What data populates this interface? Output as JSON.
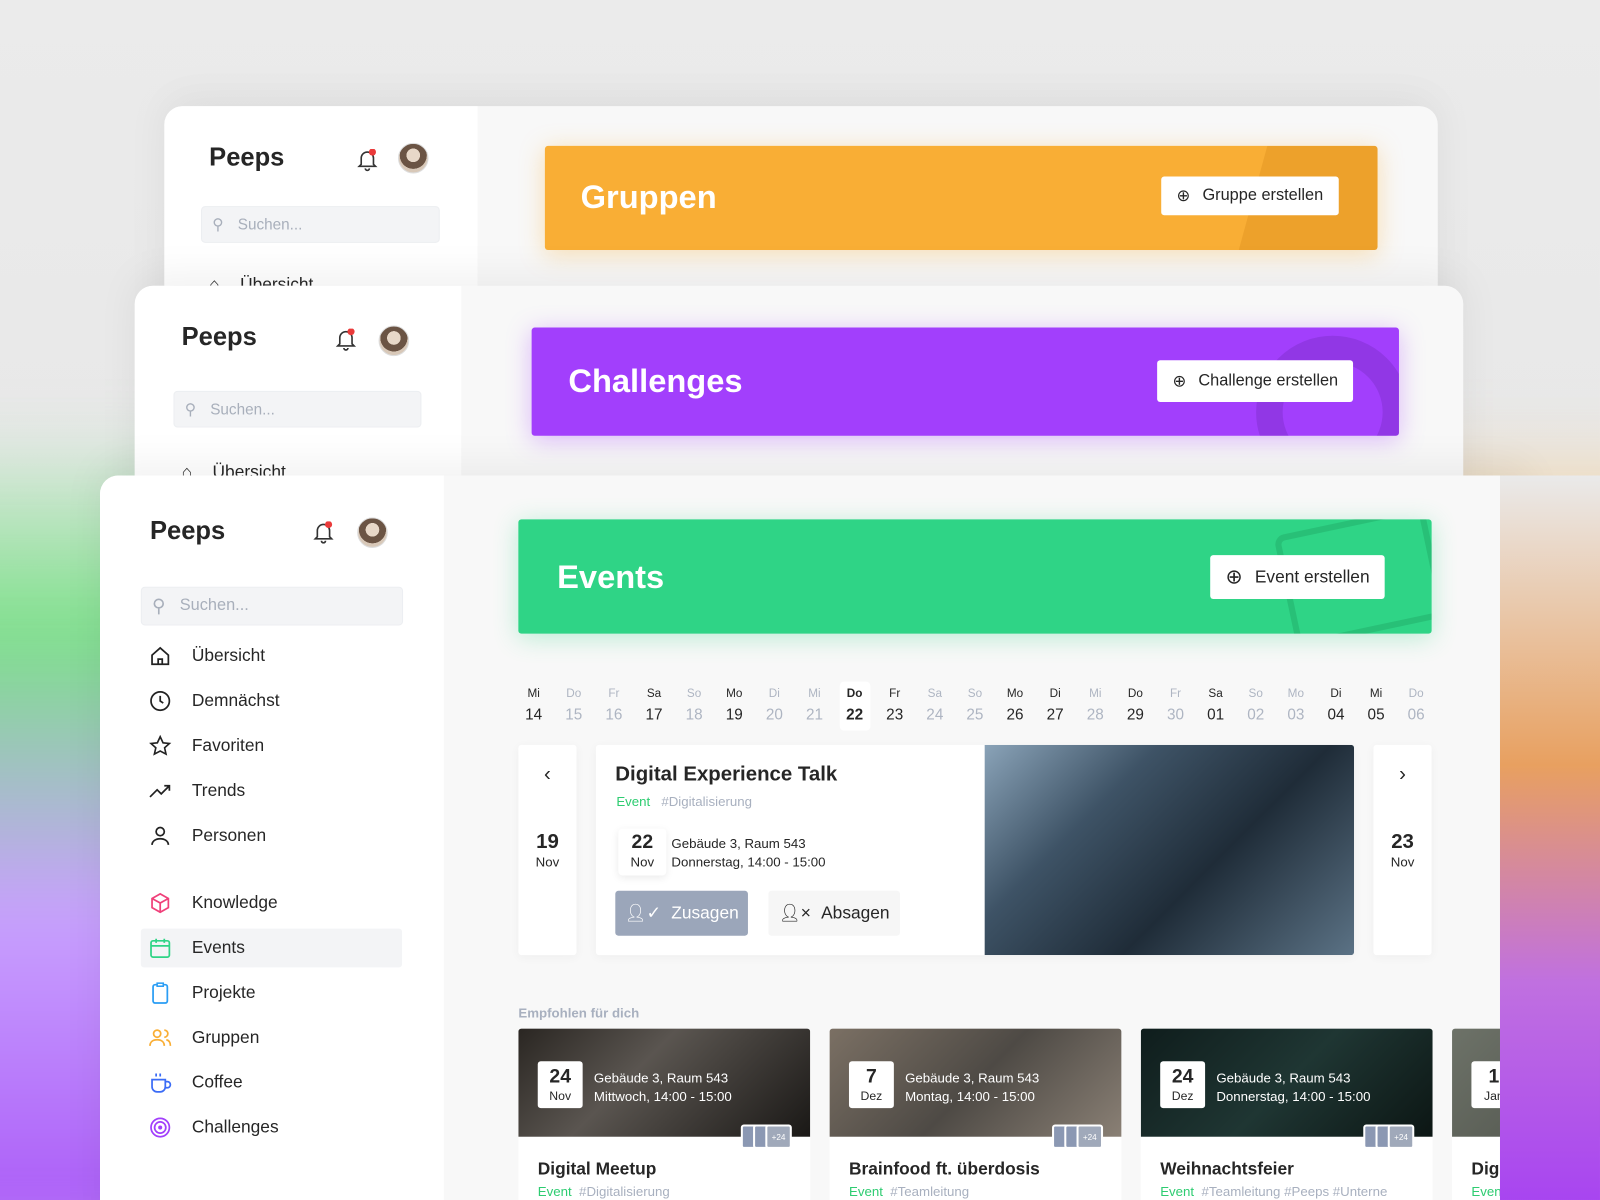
{
  "app_name": "Peeps",
  "search_placeholder": "Suchen...",
  "windows": {
    "groups": {
      "title": "Gruppen",
      "button": "Gruppe erstellen",
      "color": "#f9ae35",
      "first_nav": "Übersicht"
    },
    "challenges": {
      "title": "Challenges",
      "button": "Challenge erstellen",
      "color": "#a23ffc",
      "first_nav": "Übersicht"
    },
    "events": {
      "title": "Events",
      "button": "Event erstellen",
      "color": "#2fd486"
    }
  },
  "sidebar": {
    "items": [
      {
        "label": "Übersicht",
        "icon": "home-icon"
      },
      {
        "label": "Demnächst",
        "icon": "clock-icon"
      },
      {
        "label": "Favoriten",
        "icon": "star-icon"
      },
      {
        "label": "Trends",
        "icon": "trending-icon"
      },
      {
        "label": "Personen",
        "icon": "person-icon"
      },
      {
        "label": "Knowledge",
        "icon": "cube-icon"
      },
      {
        "label": "Events",
        "icon": "calendar-icon"
      },
      {
        "label": "Projekte",
        "icon": "clipboard-icon"
      },
      {
        "label": "Gruppen",
        "icon": "users-icon"
      },
      {
        "label": "Coffee",
        "icon": "coffee-icon"
      },
      {
        "label": "Challenges",
        "icon": "target-icon"
      }
    ]
  },
  "dates": [
    {
      "d": "Mi",
      "n": "14"
    },
    {
      "d": "Do",
      "n": "15",
      "m": 1
    },
    {
      "d": "Fr",
      "n": "16",
      "m": 1
    },
    {
      "d": "Sa",
      "n": "17"
    },
    {
      "d": "So",
      "n": "18",
      "m": 1
    },
    {
      "d": "Mo",
      "n": "19"
    },
    {
      "d": "Di",
      "n": "20",
      "m": 1
    },
    {
      "d": "Mi",
      "n": "21",
      "m": 1
    },
    {
      "d": "Do",
      "n": "22",
      "s": 1
    },
    {
      "d": "Fr",
      "n": "23"
    },
    {
      "d": "Sa",
      "n": "24",
      "m": 1
    },
    {
      "d": "So",
      "n": "25",
      "m": 1
    },
    {
      "d": "Mo",
      "n": "26"
    },
    {
      "d": "Di",
      "n": "27"
    },
    {
      "d": "Mi",
      "n": "28",
      "m": 1
    },
    {
      "d": "Do",
      "n": "29"
    },
    {
      "d": "Fr",
      "n": "30",
      "m": 1
    },
    {
      "d": "Sa",
      "n": "01"
    },
    {
      "d": "So",
      "n": "02",
      "m": 1
    },
    {
      "d": "Mo",
      "n": "03",
      "m": 1
    },
    {
      "d": "Di",
      "n": "04"
    },
    {
      "d": "Mi",
      "n": "05"
    },
    {
      "d": "Do",
      "n": "06",
      "m": 1
    }
  ],
  "featured": {
    "prev": {
      "day": "19",
      "month": "Nov"
    },
    "next": {
      "day": "23",
      "month": "Nov"
    },
    "title": "Digital Experience Talk",
    "type": "Event",
    "tag": "#Digitalisierung",
    "day": "22",
    "month": "Nov",
    "location": "Gebäude 3, Raum 543",
    "time": "Donnerstag, 14:00 - 15:00",
    "accept": "Zusagen",
    "decline": "Absagen"
  },
  "recommended_label": "Empfohlen für dich",
  "recommended": [
    {
      "day": "24",
      "month": "Nov",
      "location": "Gebäude 3, Raum 543",
      "time": "Mittwoch, 14:00 - 15:00",
      "title": "Digital Meetup",
      "type": "Event",
      "tags": "#Digitalisierung",
      "count": "+24"
    },
    {
      "day": "7",
      "month": "Dez",
      "location": "Gebäude 3, Raum 543",
      "time": "Montag, 14:00 - 15:00",
      "title": "Brainfood ft. überdosis",
      "type": "Event",
      "tags": "#Teamleitung",
      "count": "+24"
    },
    {
      "day": "24",
      "month": "Dez",
      "location": "Gebäude 3, Raum 543",
      "time": "Donnerstag, 14:00 - 15:00",
      "title": "Weihnachtsfeier",
      "type": "Event",
      "tags": "#Teamleitung #Peeps #Unterne",
      "count": "+24"
    },
    {
      "day": "1",
      "month": "Jan",
      "title": "Digi",
      "type": "Even"
    }
  ]
}
